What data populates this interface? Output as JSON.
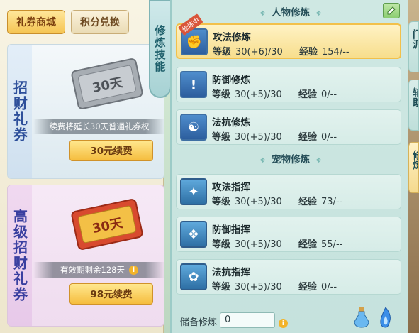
{
  "shop": {
    "tabs": [
      {
        "label": "礼券商城",
        "active": true
      },
      {
        "label": "积分兑换",
        "active": false
      }
    ],
    "cards": [
      {
        "vertical_label": "招财礼券",
        "ticket_text": "30天",
        "description": "续费将延长30天普通礼券权",
        "button": "30元续费"
      },
      {
        "vertical_label": "高级招财礼券",
        "ticket_text": "30天",
        "description": "有效期剩余128天",
        "button": "98元续费"
      }
    ]
  },
  "skill_tab": {
    "label": "修炼技能"
  },
  "panel": {
    "sections": {
      "character": "人物修炼",
      "pet": "宠物修炼"
    },
    "character_rows": [
      {
        "name": "攻法修炼",
        "level": "30(+6)/30",
        "exp": "154/--",
        "badge": "修炼中",
        "icon": "fist-icon",
        "selected": true
      },
      {
        "name": "防御修炼",
        "level": "30(+5)/30",
        "exp": "0/--",
        "badge": "",
        "icon": "shield-icon",
        "selected": false
      },
      {
        "name": "法抗修炼",
        "level": "30(+5)/30",
        "exp": "0/--",
        "badge": "",
        "icon": "yinyang-icon",
        "selected": false
      }
    ],
    "pet_rows": [
      {
        "name": "攻法指挥",
        "level": "30(+5)/30",
        "exp": "73/--",
        "icon": "claw-icon"
      },
      {
        "name": "防御指挥",
        "level": "30(+5)/30",
        "exp": "55/--",
        "icon": "paw-shield-icon"
      },
      {
        "name": "法抗指挥",
        "level": "30(+5)/30",
        "exp": "0/--",
        "icon": "paw-ward-icon"
      }
    ],
    "level_label": "等级",
    "exp_label": "经验",
    "reserve_label": "储备修炼",
    "reserve_value": "0"
  },
  "side_tabs": [
    {
      "label": "门派",
      "active": false
    },
    {
      "label": "辅助",
      "active": false
    },
    {
      "label": "修炼",
      "active": true
    }
  ],
  "colors": {
    "selected_row": "#f7de8d",
    "panel_bg": "#cfe8e3",
    "button_gold": "#f5bd3e"
  }
}
